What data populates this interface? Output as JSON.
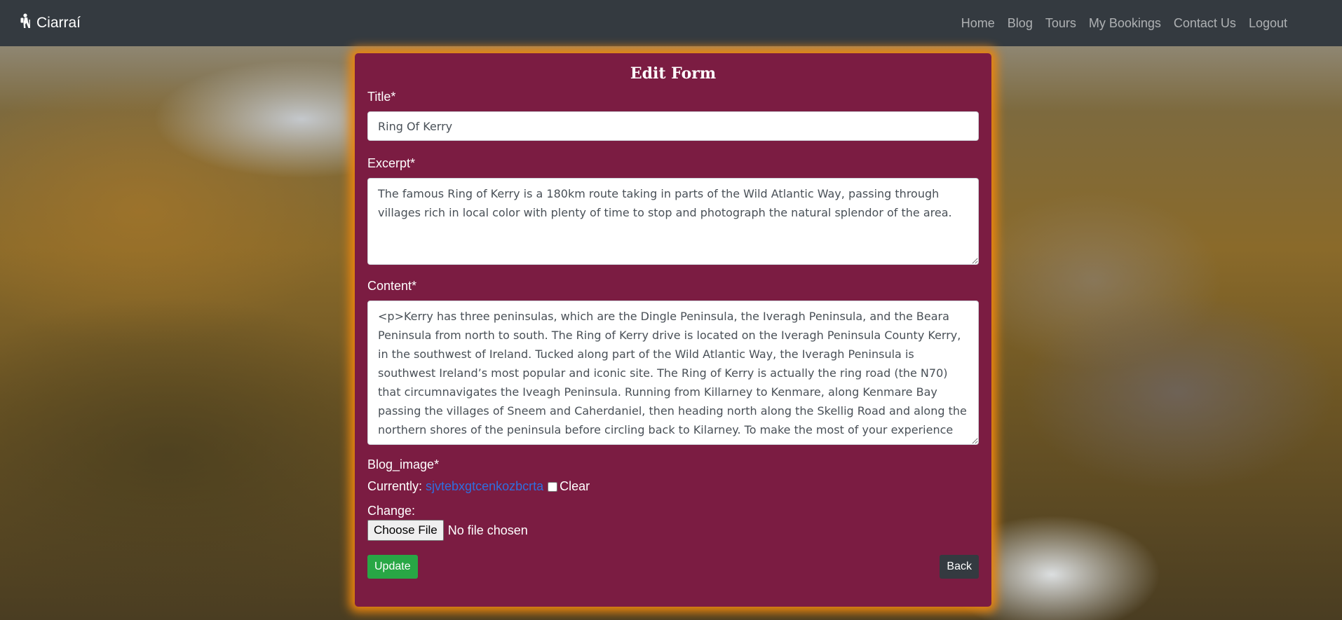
{
  "navbar": {
    "brand": "Ciarraí",
    "brand_icon": "hiking-icon",
    "links": [
      {
        "label": "Home"
      },
      {
        "label": "Blog"
      },
      {
        "label": "Tours"
      },
      {
        "label": "My Bookings"
      },
      {
        "label": "Contact Us"
      },
      {
        "label": "Logout"
      }
    ]
  },
  "form": {
    "heading": "Edit Form",
    "title_label": "Title*",
    "title_value": "Ring Of Kerry",
    "excerpt_label": "Excerpt*",
    "excerpt_value": "The famous Ring of Kerry is a 180km route taking in parts of the Wild Atlantic Way, passing through villages rich in local color with plenty of time to stop and photograph the natural splendor of the area.",
    "content_label": "Content*",
    "content_value": "<p>Kerry has three peninsulas, which are the Dingle Peninsula, the Iveragh Peninsula, and the Beara Peninsula from north to south. The Ring of Kerry drive is located on the Iveragh Peninsula County Kerry, in the southwest of Ireland. Tucked along part of the Wild Atlantic Way, the Iveragh Peninsula is southwest Ireland’s most popular and iconic site. The Ring of Kerry is actually the ring road (the N70) that circumnavigates the Iveagh Peninsula. Running from Killarney to Kenmare, along Kenmare Bay passing the villages of Sneem and Caherdaniel, then heading north along the Skellig Road and along the northern shores of the peninsula before circling back to Kilarney. To make the most of your experience along this",
    "image_label": "Blog_image*",
    "currently_label": "Currently:",
    "current_file": "sjvtebxgtcenkozbcrta",
    "clear_label": "Clear",
    "change_label": "Change:",
    "choose_file_label": "Choose File",
    "no_file_label": "No file chosen",
    "update_label": "Update",
    "back_label": "Back"
  },
  "colors": {
    "navbar": "#343a40",
    "card": "#7b1c42",
    "card_glow": "#e8850f",
    "update": "#28a745",
    "back": "#343a40",
    "link": "#2f6fe0"
  }
}
